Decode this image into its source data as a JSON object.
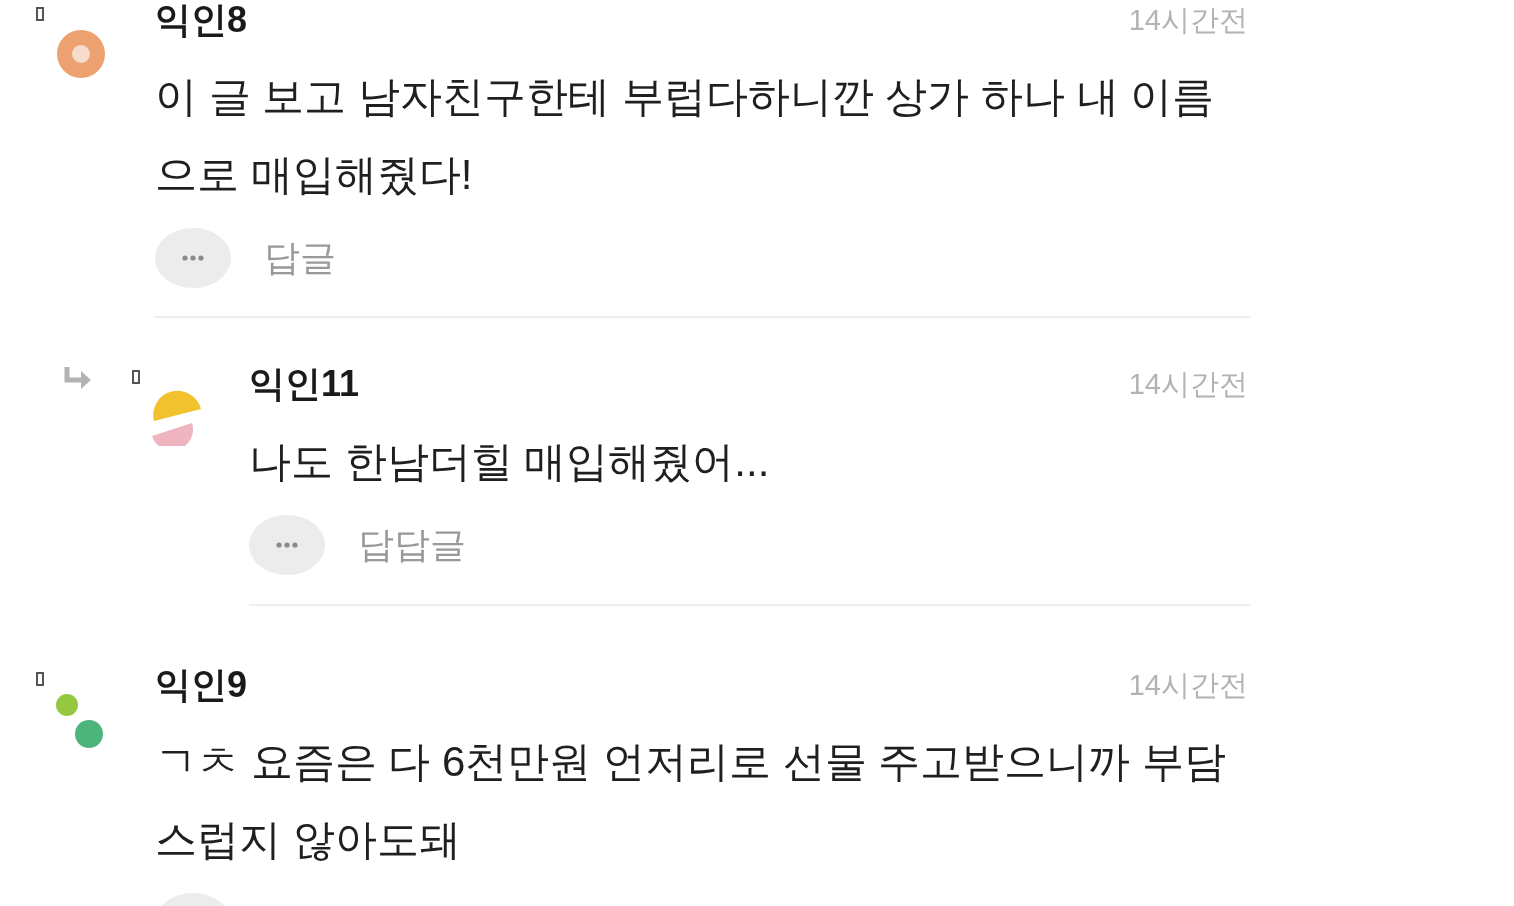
{
  "comments": [
    {
      "kind": "comment",
      "author": "익인8",
      "time": "14시간전",
      "body": "이 글 보고 남자친구한테 부럽다하니깐 상가 하나 내 이름으로 매입해줬다!",
      "reply_label": "답글"
    },
    {
      "kind": "reply",
      "author": "익인11",
      "time": "14시간전",
      "body": "나도 한남더힐 매입해줬어...",
      "reply_label": "답답글"
    },
    {
      "kind": "comment",
      "author": "익인9",
      "time": "14시간전",
      "body": "ㄱㅊ 요즘은 다 6천만원 언저리로 선물 주고받으니까 부담스럽지 않아도돼"
    }
  ]
}
